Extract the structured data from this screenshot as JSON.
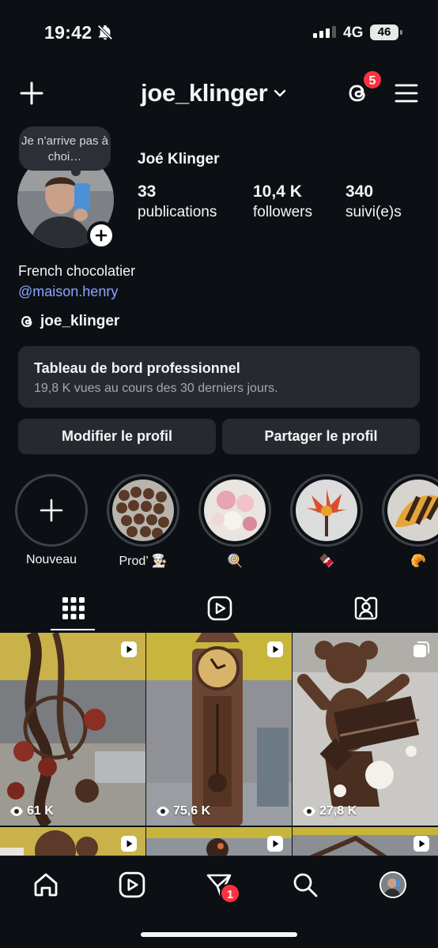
{
  "status_bar": {
    "time": "19:42",
    "network": "4G",
    "battery": "46"
  },
  "top_bar": {
    "username": "joe_klinger",
    "threads_badge": "5"
  },
  "profile": {
    "note": "Je n’arrive pas à choi…",
    "full_name": "Joé Klinger",
    "stats": [
      {
        "value": "33",
        "label": "publications"
      },
      {
        "value": "10,4 K",
        "label": "followers"
      },
      {
        "value": "340",
        "label": "suivi(e)s"
      }
    ],
    "bio": "French chocolatier",
    "bio_link": "@maison.henry",
    "threads_handle": "joe_klinger"
  },
  "dashboard": {
    "title": "Tableau de bord professionnel",
    "subtitle": "19,8 K vues au cours des 30 derniers jours."
  },
  "buttons": {
    "edit": "Modifier le profil",
    "share": "Partager le profil"
  },
  "highlights": [
    {
      "label": "Nouveau"
    },
    {
      "label": "Prod’ 👨🏻‍🍳"
    },
    {
      "label": "🍭"
    },
    {
      "label": "🍫"
    },
    {
      "label": "🥐"
    }
  ],
  "grid": [
    {
      "views": "61 K",
      "type": "reel"
    },
    {
      "views": "75,6 K",
      "type": "reel"
    },
    {
      "views": "27,8 K",
      "type": "carousel"
    }
  ],
  "bottom_nav": {
    "messages_badge": "1"
  },
  "colors": {
    "background": "#0c1014",
    "surface": "#262a30",
    "link": "#8aa5ff",
    "badge": "#ff3040"
  }
}
